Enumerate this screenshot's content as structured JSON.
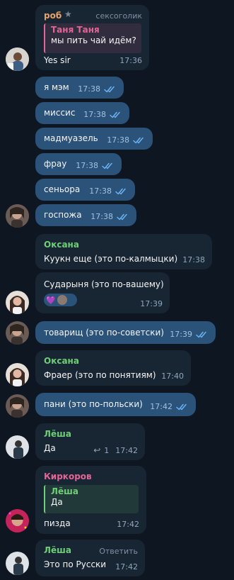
{
  "theme": {
    "background": "#0e1621",
    "incoming_bubble": "#182533",
    "outgoing_bubble": "#2b5278",
    "color_rob": "#e8a26b",
    "color_tanya": "#e56497",
    "color_green": "#6fcf77",
    "color_kirkorov": "#e56497",
    "read_ticks": "#6ab3f3"
  },
  "messages": {
    "rob": {
      "sender": "роб",
      "star_icon": "star-icon",
      "role_badge": "сексоголик",
      "reply_name": "Таня Таня",
      "reply_text": "мы пить чай идём?",
      "text": "Yes sir",
      "time": "17:36"
    },
    "out1": {
      "text": "я мэм",
      "time": "17:38"
    },
    "out2": {
      "text": "миссис",
      "time": "17:38"
    },
    "out3": {
      "text": "мадмуазель",
      "time": "17:38"
    },
    "out4": {
      "text": "фрау",
      "time": "17:38"
    },
    "out5": {
      "text": "сеньора",
      "time": "17:38"
    },
    "out6": {
      "text": "госпожа",
      "time": "17:38"
    },
    "oksana1": {
      "sender": "Оксана",
      "text": "Куукн еще (это по-калмыцки)",
      "time": "17:38"
    },
    "oksana2": {
      "text": "Сударыня (это по-вашему)",
      "time": "17:39",
      "reactions": [
        "heart-reaction",
        "avatar-reaction"
      ]
    },
    "out7": {
      "text": "товарищ (это по-советски)",
      "time": "17:39"
    },
    "oksana3": {
      "sender": "Оксана",
      "text": "Фраер (это по понятиям)",
      "time": "17:40"
    },
    "out8": {
      "text": "пани (это по-польски)",
      "time": "17:42"
    },
    "lesha1": {
      "sender": "Лёша",
      "text": "Да",
      "replies_count": "1",
      "time": "17:42"
    },
    "kirkorov": {
      "sender": "Киркоров",
      "reply_name": "Лёша",
      "reply_text": "Да",
      "text": "пизда",
      "time": "17:42"
    },
    "lesha2": {
      "sender": "Лёша",
      "reply_action": "Ответить",
      "text": "Это по Русски",
      "time": "17:42"
    }
  }
}
